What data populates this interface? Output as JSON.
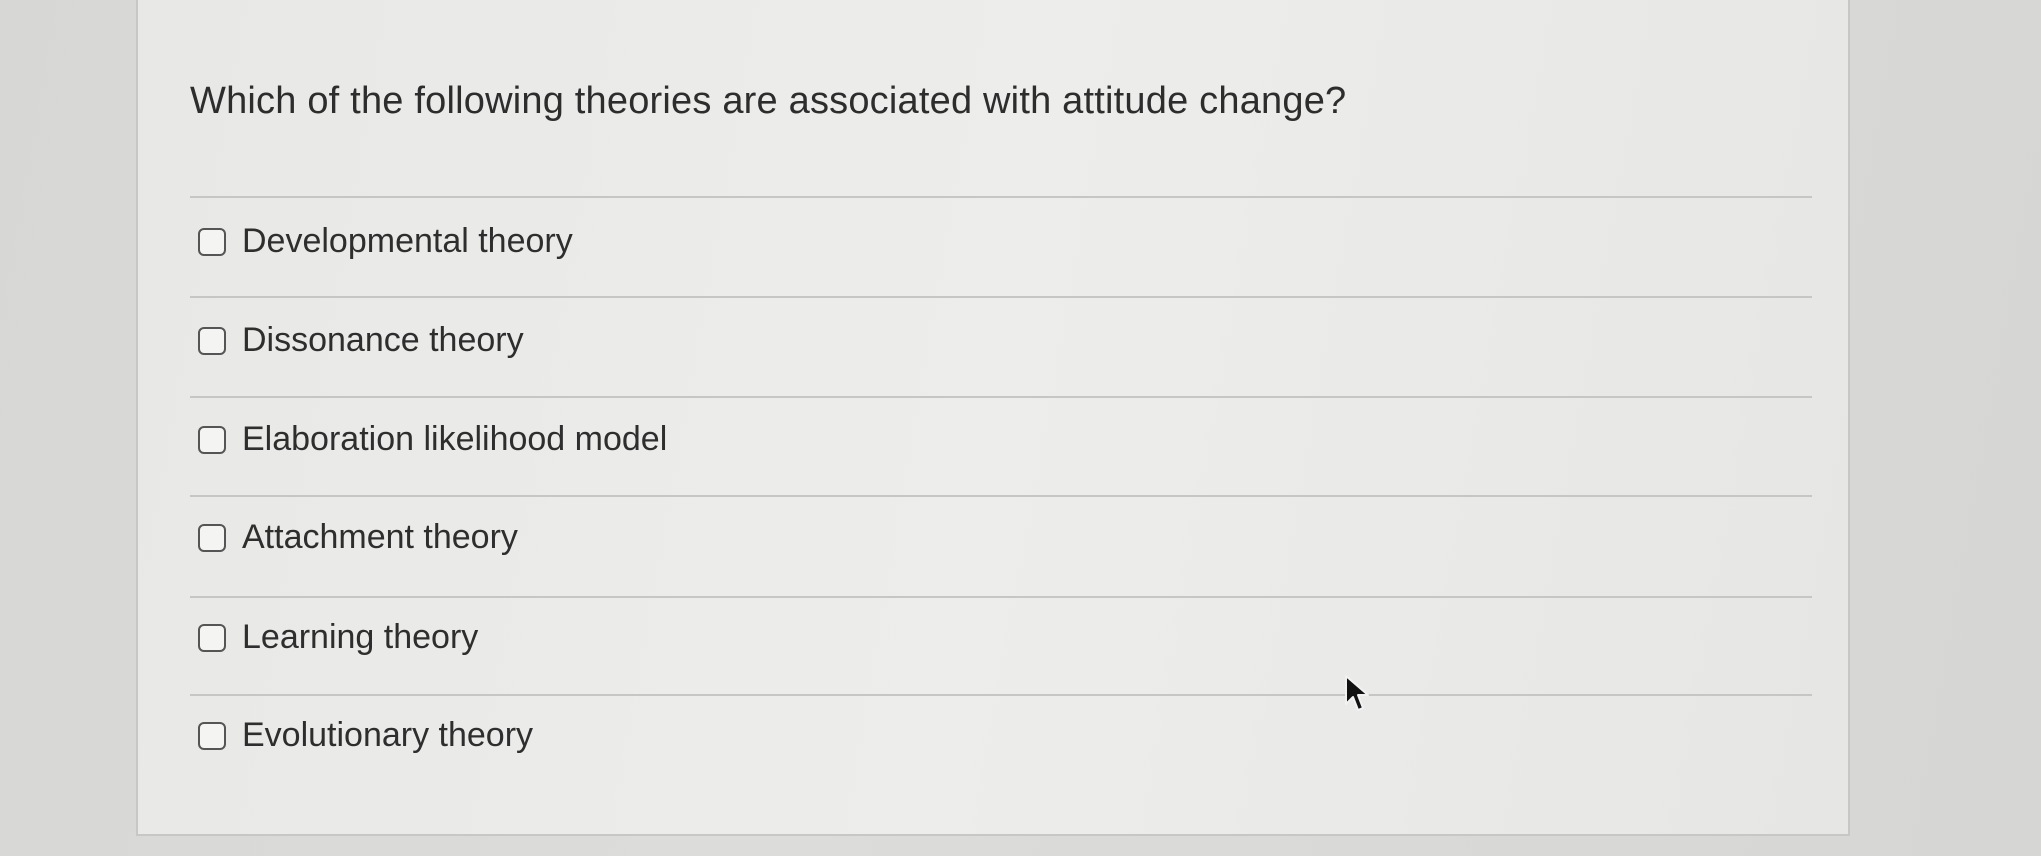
{
  "question": {
    "text": "Which of the following theories are associated with attitude change?"
  },
  "options": [
    {
      "label": "Developmental theory",
      "checked": false
    },
    {
      "label": "Dissonance theory",
      "checked": false
    },
    {
      "label": "Elaboration likelihood model",
      "checked": false
    },
    {
      "label": "Attachment theory",
      "checked": false
    },
    {
      "label": "Learning theory",
      "checked": false
    },
    {
      "label": "Evolutionary theory",
      "checked": false
    }
  ],
  "icons": {
    "cursor": "mouse-pointer-icon"
  },
  "colors": {
    "background": "#d9d9d7",
    "panel": "#ebebe9",
    "text": "#2d2d2d",
    "divider": "#c6c6c4"
  }
}
